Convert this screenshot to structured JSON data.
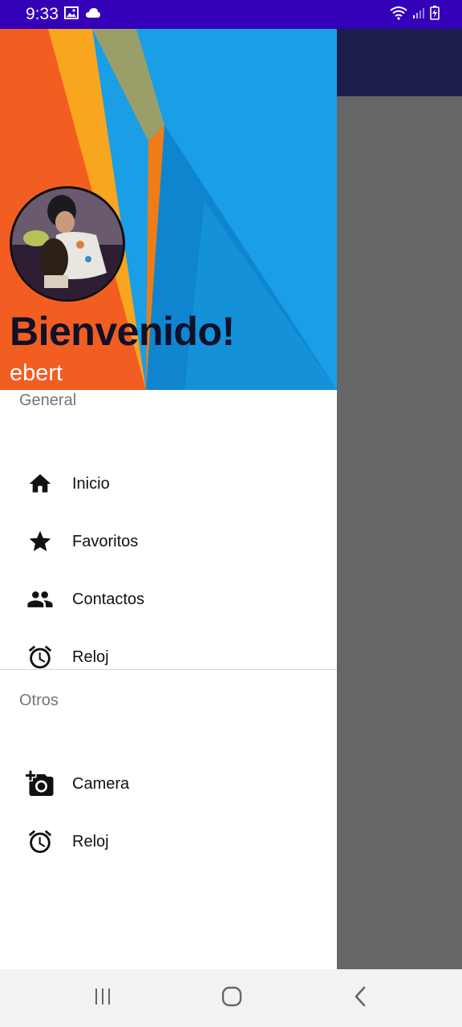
{
  "status_bar": {
    "time": "9:33",
    "left_icons": [
      "image-icon",
      "cloud-icon"
    ],
    "right_icons": [
      "wifi-icon",
      "signal-icon",
      "battery-icon"
    ]
  },
  "drawer": {
    "header": {
      "title": "Bienvenido!",
      "subtitle": "ebert"
    },
    "sections": [
      {
        "title": "General",
        "items": [
          {
            "label": "Inicio",
            "icon": "home-icon"
          },
          {
            "label": "Favoritos",
            "icon": "star-icon"
          },
          {
            "label": "Contactos",
            "icon": "people-icon"
          },
          {
            "label": "Reloj",
            "icon": "alarm-icon"
          }
        ]
      },
      {
        "title": "Otros",
        "items": [
          {
            "label": "Camera",
            "icon": "add-camera-icon"
          },
          {
            "label": "Reloj",
            "icon": "alarm-icon"
          }
        ]
      }
    ]
  },
  "nav_bar": {
    "buttons": [
      "recents-icon",
      "home-button-icon",
      "back-icon"
    ]
  },
  "colors": {
    "status_bar": "#3400b8",
    "toolbar": "#1a1e48",
    "scrim": "#666666",
    "header_orange": "#f25d22",
    "header_yellow": "#f8a51f",
    "header_blue": "#1091dc"
  }
}
